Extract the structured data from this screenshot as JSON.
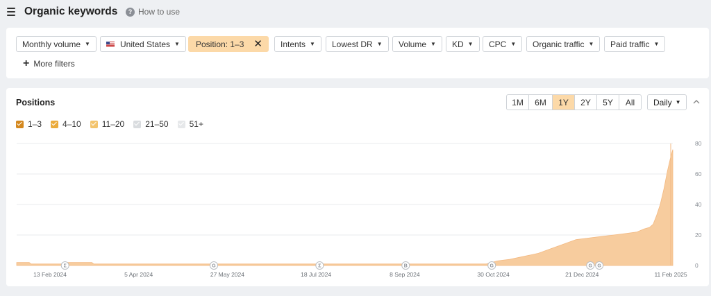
{
  "header": {
    "title": "Organic keywords",
    "how_to_use": "How to use",
    "help_icon_glyph": "?"
  },
  "filters": {
    "chips": [
      {
        "label": "Monthly volume",
        "caret": "▼"
      },
      {
        "label": "United States",
        "caret": "▼",
        "icon": "us-flag-icon"
      },
      {
        "label": "Position: 1–3",
        "close": "✕",
        "active": true
      },
      {
        "label": "Intents",
        "caret": "▼"
      },
      {
        "label": "Lowest DR",
        "caret": "▼"
      },
      {
        "label": "Volume",
        "caret": "▼"
      },
      {
        "label": "KD",
        "caret": "▼"
      },
      {
        "label": "CPC",
        "caret": "▼"
      },
      {
        "label": "Organic traffic",
        "caret": "▼"
      },
      {
        "label": "Paid traffic",
        "caret": "▼"
      }
    ],
    "more_filters": "More filters",
    "plus_glyph": "+"
  },
  "positions": {
    "title": "Positions",
    "legend": [
      {
        "label": "1–3",
        "color": "#d4881e",
        "checked": true
      },
      {
        "label": "4–10",
        "color": "#ebab3c",
        "checked": true
      },
      {
        "label": "11–20",
        "color": "#f3c46d",
        "checked": true
      },
      {
        "label": "21–50",
        "color": "#d9dcdf",
        "checked": true
      },
      {
        "label": "51+",
        "color": "#e6e8ea",
        "checked": true
      }
    ],
    "range_buttons": [
      "1M",
      "6M",
      "1Y",
      "2Y",
      "5Y",
      "All"
    ],
    "selected_range": "1Y",
    "interval": "Daily",
    "interval_caret": "▼",
    "colors": {
      "area": "#f7cc9e",
      "area_line": "#f3b982",
      "grid": "#e9ebee",
      "accent": "#fcd9a8"
    }
  },
  "chart_data": {
    "type": "area",
    "x_tick_labels": [
      "13 Feb 2024",
      "5 Apr 2024",
      "27 May 2024",
      "18 Jul 2024",
      "8 Sep 2024",
      "30 Oct 2024",
      "21 Dec 2024",
      "11 Feb 2025"
    ],
    "y_tick_labels": [
      "0",
      "20",
      "40",
      "60",
      "80"
    ],
    "ylim": [
      0,
      80
    ],
    "xlim": [
      "2024-02-11",
      "2025-02-11"
    ],
    "grid": true,
    "series": [
      {
        "values": [
          [
            "2024-02-11",
            0
          ],
          [
            "2024-02-11",
            2
          ],
          [
            "2024-02-18",
            2
          ],
          [
            "2024-02-19",
            1
          ],
          [
            "2024-03-08",
            1
          ],
          [
            "2024-03-09",
            2
          ],
          [
            "2024-03-24",
            2
          ],
          [
            "2024-03-25",
            1
          ],
          [
            "2024-05-24",
            1
          ],
          [
            "2024-05-25",
            1
          ],
          [
            "2024-06-20",
            1
          ],
          [
            "2024-06-21",
            1
          ],
          [
            "2024-07-20",
            1
          ],
          [
            "2024-08-15",
            1
          ],
          [
            "2024-10-30",
            1
          ],
          [
            "2024-11-05",
            3
          ],
          [
            "2024-11-12",
            4
          ],
          [
            "2024-11-20",
            6
          ],
          [
            "2024-11-28",
            8
          ],
          [
            "2024-12-05",
            11
          ],
          [
            "2024-12-12",
            14
          ],
          [
            "2024-12-19",
            17
          ],
          [
            "2024-12-26",
            18
          ],
          [
            "2025-01-02",
            19
          ],
          [
            "2025-01-09",
            20
          ],
          [
            "2025-01-16",
            21
          ],
          [
            "2025-01-22",
            22
          ],
          [
            "2025-01-26",
            24
          ],
          [
            "2025-01-29",
            25
          ],
          [
            "2025-01-31",
            27
          ],
          [
            "2025-02-02",
            33
          ],
          [
            "2025-02-04",
            40
          ],
          [
            "2025-02-06",
            50
          ],
          [
            "2025-02-08",
            62
          ],
          [
            "2025-02-10",
            72
          ],
          [
            "2025-02-11",
            76
          ],
          [
            "2025-02-11",
            0
          ]
        ]
      }
    ],
    "annotation_markers": [
      {
        "date": "2024-03-09",
        "label": "Σ"
      },
      {
        "date": "2024-05-31",
        "label": "G"
      },
      {
        "date": "2024-07-29",
        "label": "Σ"
      },
      {
        "date": "2024-09-15",
        "label": "B"
      },
      {
        "date": "2024-11-02",
        "label": "G"
      },
      {
        "date": "2024-12-27",
        "label": "G"
      },
      {
        "date": "2025-01-01",
        "label": "G"
      }
    ]
  }
}
